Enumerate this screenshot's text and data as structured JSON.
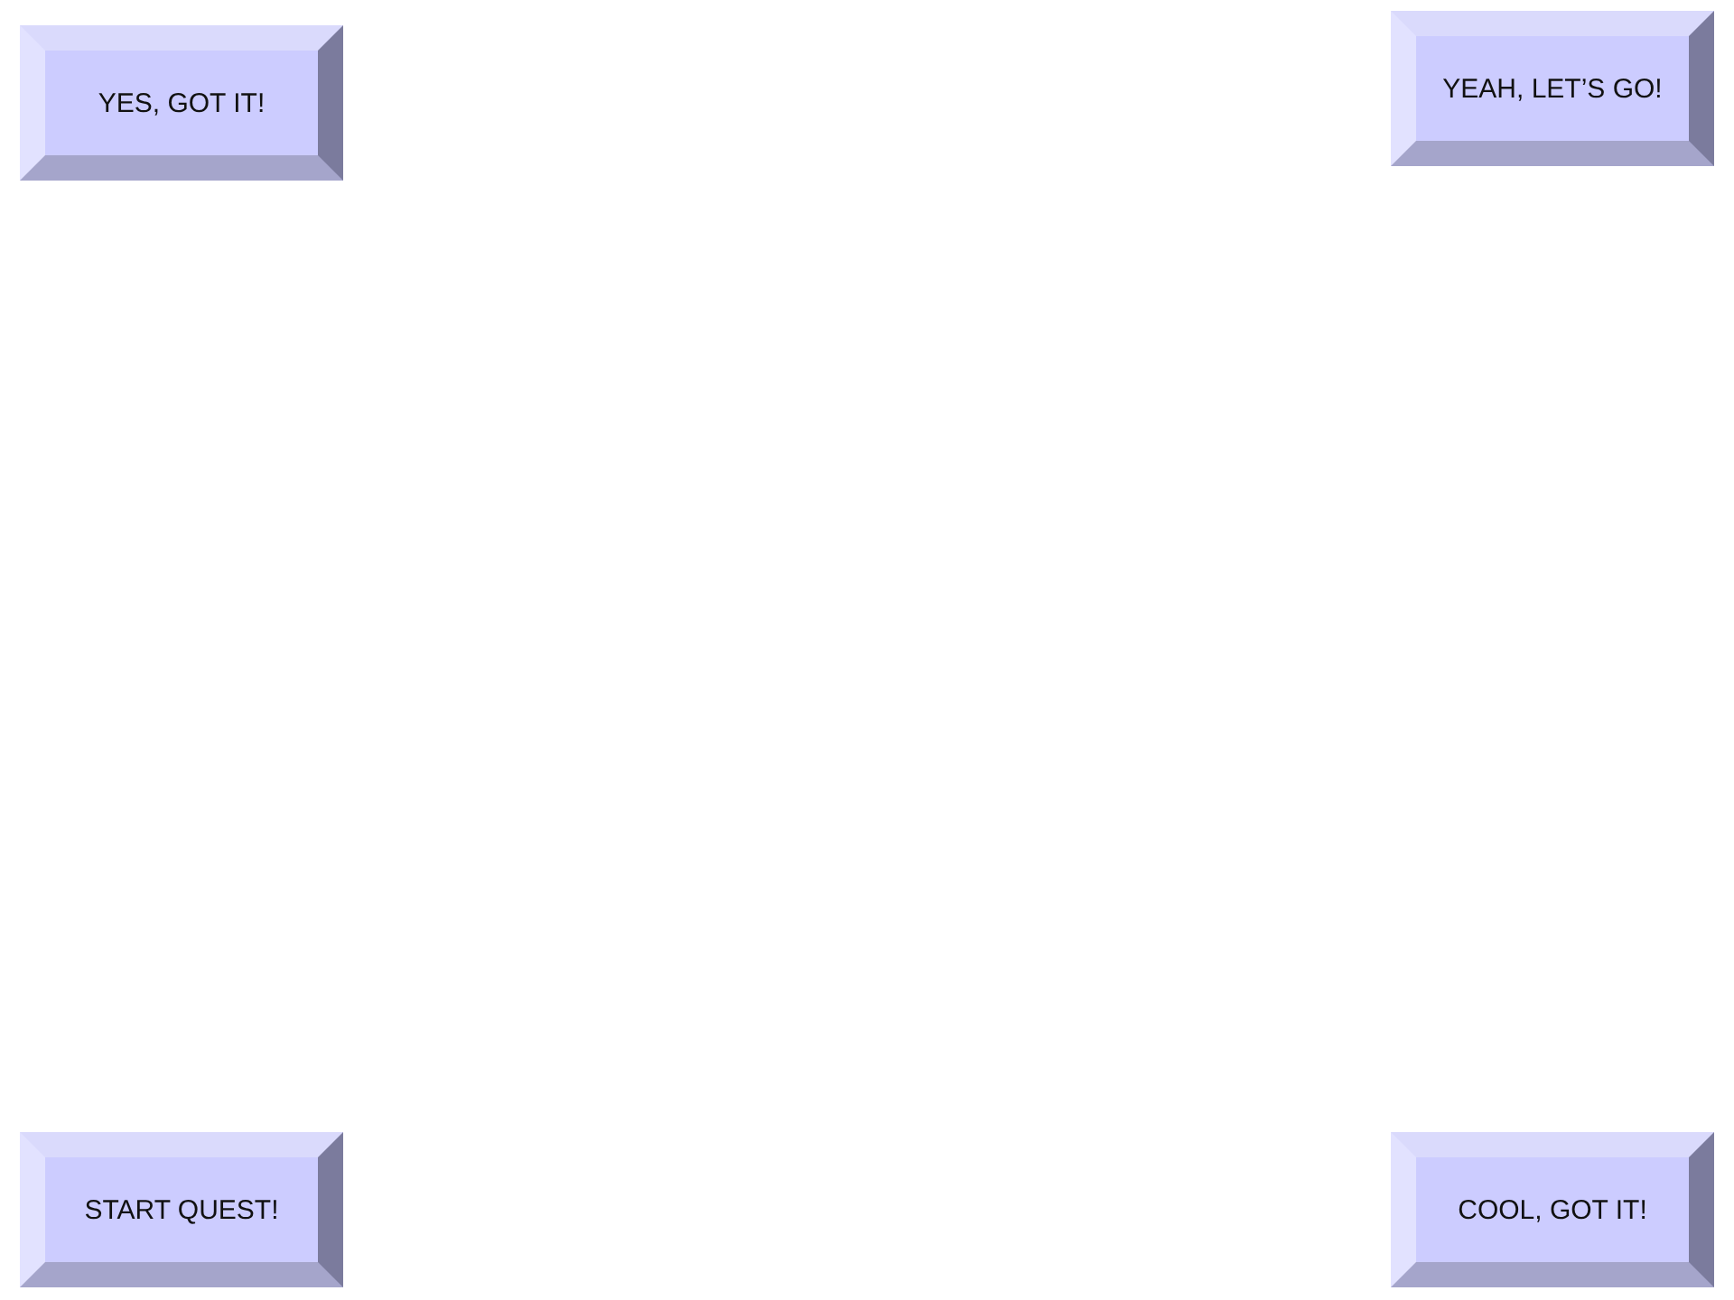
{
  "top_row": [
    {
      "label": "YES, GOT IT!"
    },
    {
      "label": "YEAH, LET’S GO!"
    }
  ],
  "bottom_row": [
    {
      "label": "START QUEST!"
    },
    {
      "label": "COOL, GOT IT!"
    }
  ]
}
